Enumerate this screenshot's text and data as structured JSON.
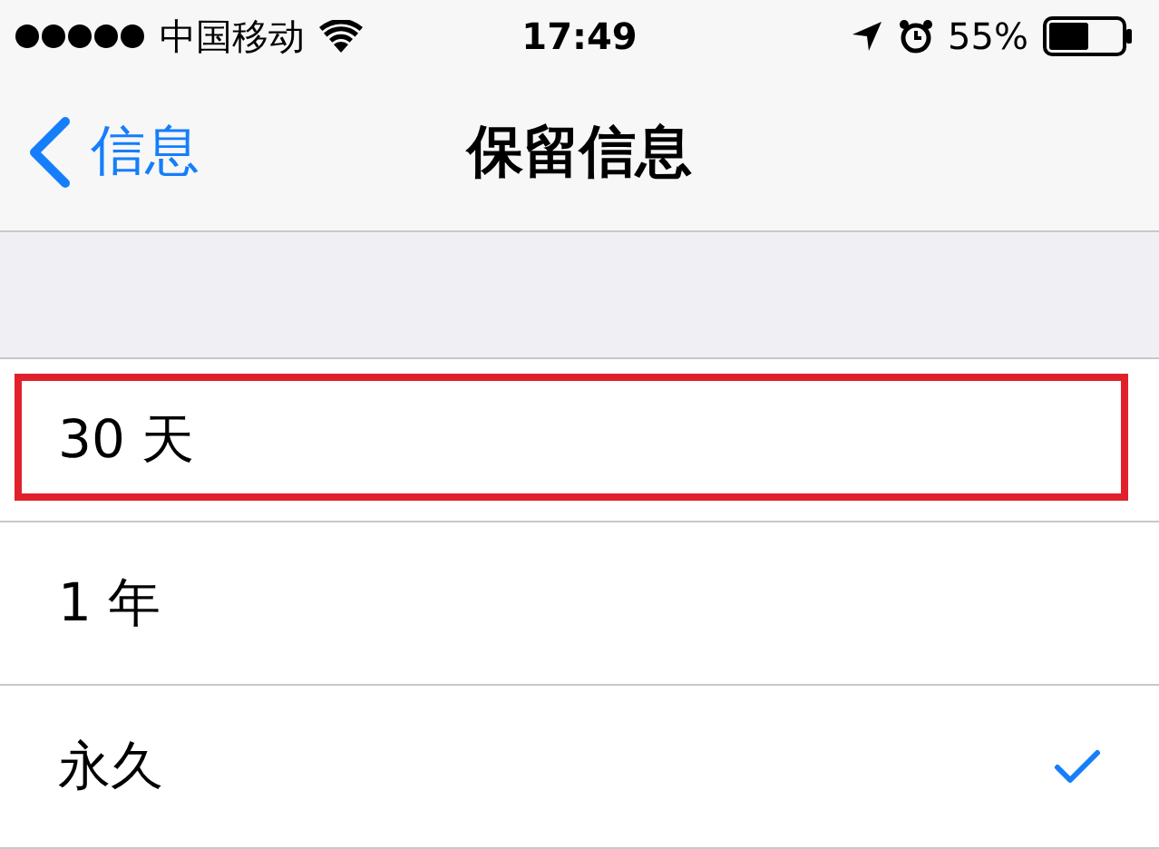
{
  "status_bar": {
    "carrier": "中国移动",
    "time": "17:49",
    "battery_text": "55%"
  },
  "nav_bar": {
    "back_label": "信息",
    "title": "保留信息"
  },
  "options": [
    {
      "label": "30 天",
      "selected": false,
      "highlighted": true
    },
    {
      "label": "1 年",
      "selected": false,
      "highlighted": false
    },
    {
      "label": "永久",
      "selected": true,
      "highlighted": false
    }
  ]
}
